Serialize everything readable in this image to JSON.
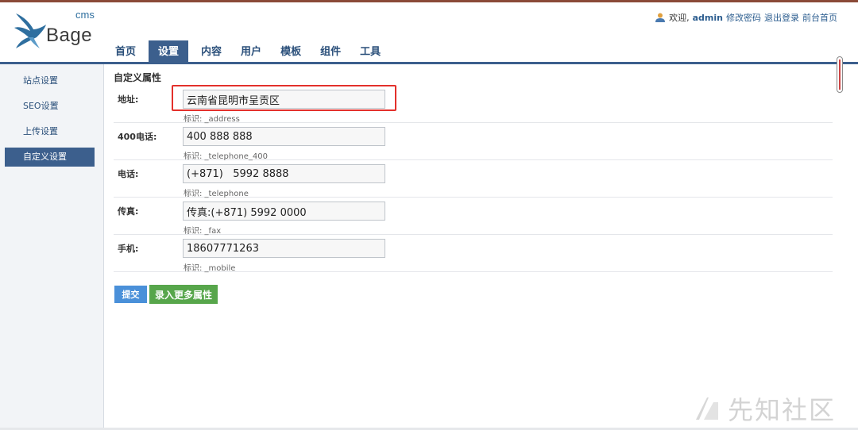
{
  "logo": {
    "cms": "cms",
    "name": "Bage"
  },
  "userbar": {
    "welcome": "欢迎,",
    "username": "admin",
    "change_password": "修改密码",
    "logout": "退出登录",
    "front_page": "前台首页"
  },
  "nav": {
    "tabs": [
      {
        "label": "首页"
      },
      {
        "label": "设置"
      },
      {
        "label": "内容"
      },
      {
        "label": "用户"
      },
      {
        "label": "模板"
      },
      {
        "label": "组件"
      },
      {
        "label": "工具"
      }
    ],
    "active_tab": "设置"
  },
  "sidebar": {
    "items": [
      {
        "label": "站点设置"
      },
      {
        "label": "SEO设置"
      },
      {
        "label": "上传设置"
      },
      {
        "label": "自定义设置"
      }
    ],
    "active_item": "自定义设置"
  },
  "main": {
    "title": "自定义属性",
    "fields": [
      {
        "label": "地址:",
        "value": "云南省昆明市呈贡区",
        "hint": "标识: _address"
      },
      {
        "label": "400电话:",
        "value": "400 888 888",
        "hint": "标识: _telephone_400"
      },
      {
        "label": "电话:",
        "value": "(+871)   5992 8888",
        "hint": "标识: _telephone"
      },
      {
        "label": "传真:",
        "value": "传真:(+871) 5992 0000",
        "hint": "标识: _fax"
      },
      {
        "label": "手机:",
        "value": "18607771263",
        "hint": "标识: _mobile"
      }
    ],
    "submit_label": "提交",
    "more_label": "录入更多属性"
  },
  "watermark": {
    "text": "先知社区"
  },
  "colors": {
    "brand": "#3c5f8d",
    "accent_top": "#8a4a38",
    "highlight": "#e3302b",
    "submit": "#4a90d9",
    "more": "#57a64b"
  }
}
